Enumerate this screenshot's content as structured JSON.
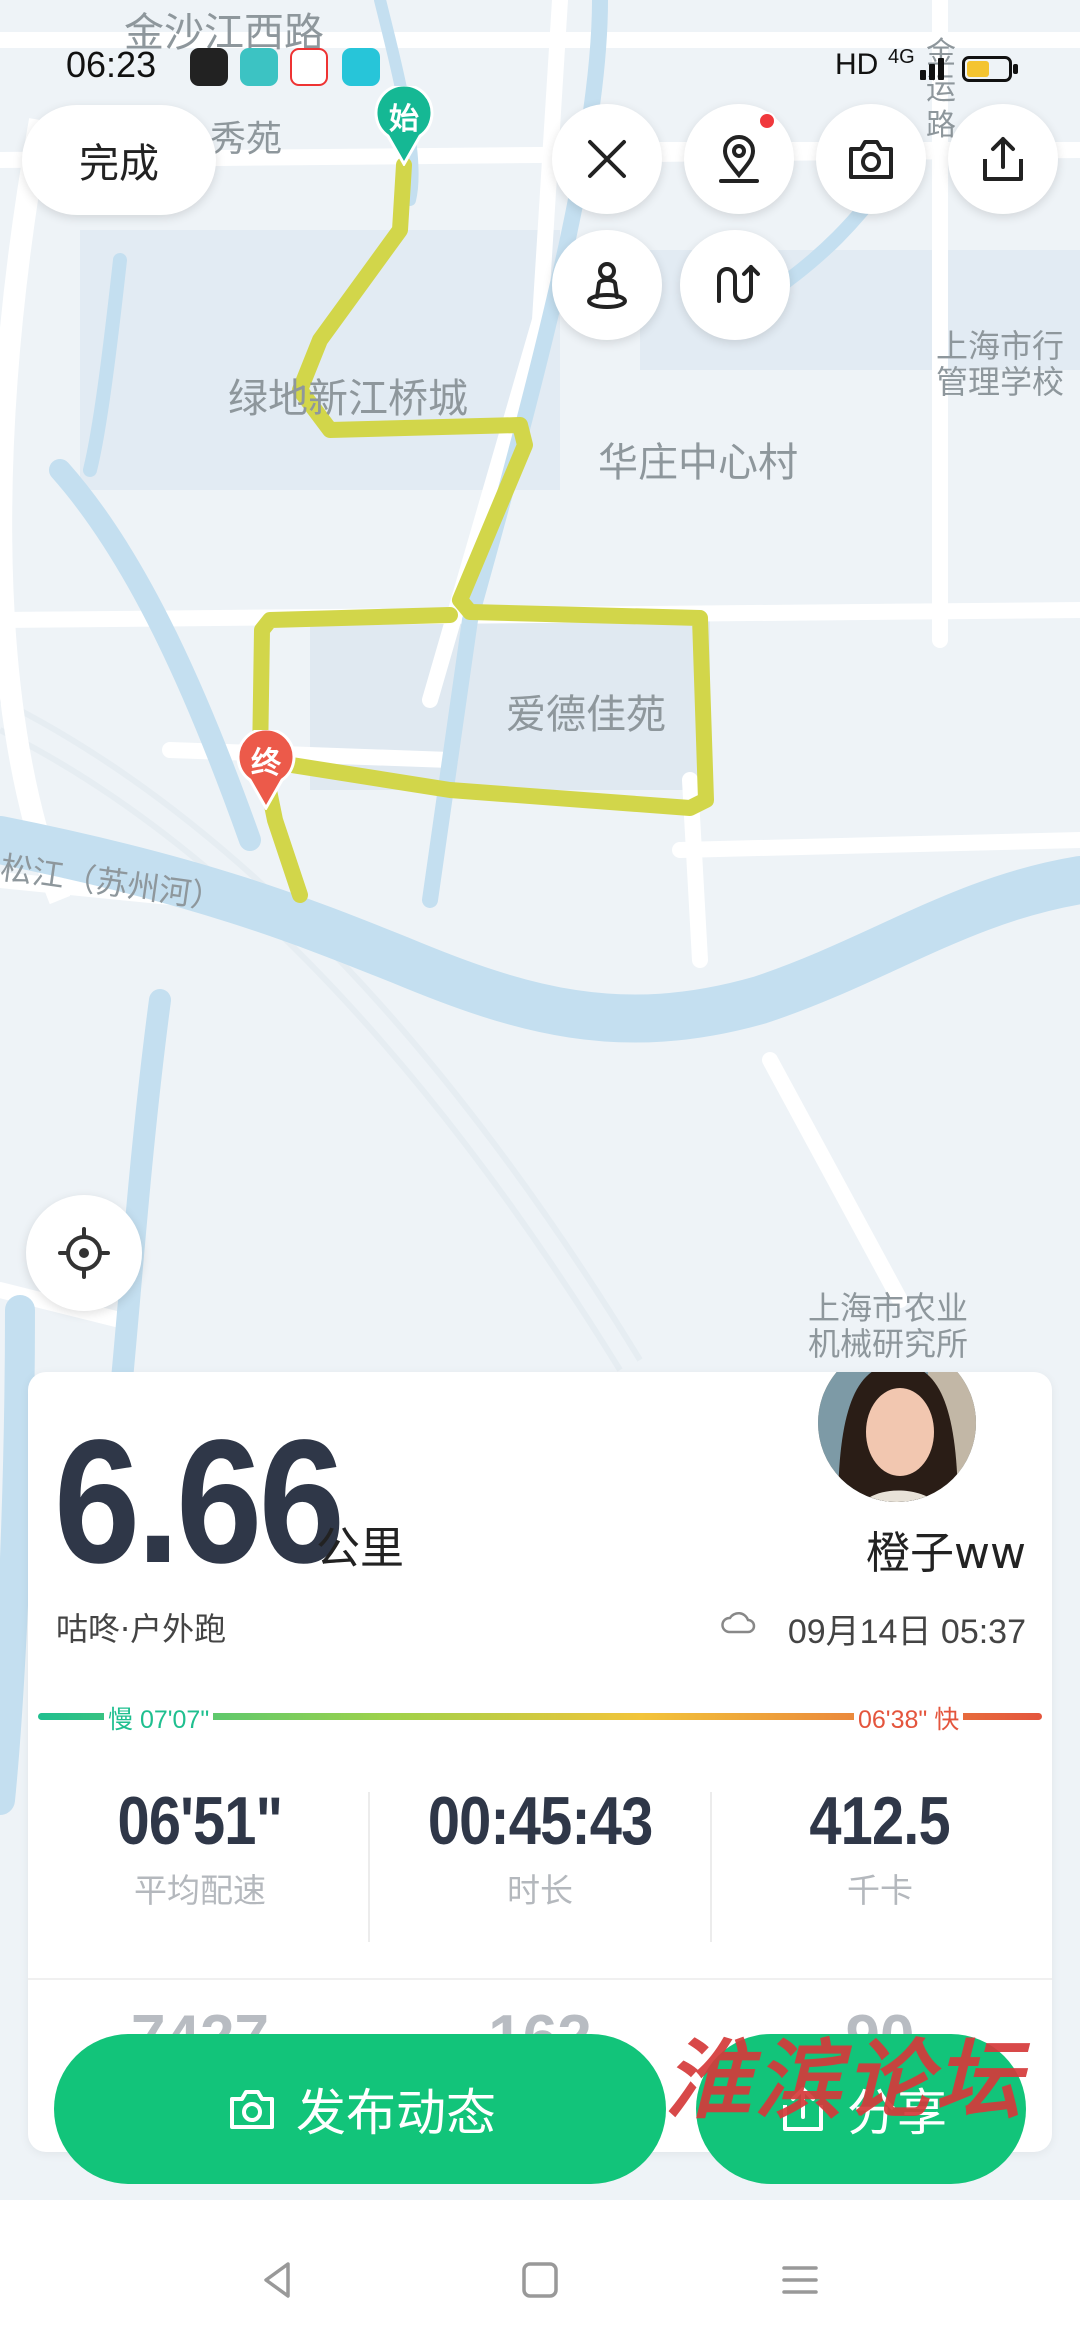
{
  "status_bar": {
    "time": "06:23",
    "network_type": "HD",
    "network_gen": "4G",
    "battery_level": 0.55,
    "battery_color": "#f4c430"
  },
  "map": {
    "labels": {
      "road_jinshajiang": "金沙江西路",
      "xiuyuan": "秀苑",
      "lvdi_xinjiangqiao": "绿地新江桥城",
      "huazhuang": "华庄中心村",
      "aidejia": "爱德佳苑",
      "suzhou_river": "松江（苏州河）",
      "admin_school_1": "上海市行",
      "admin_school_2": "管理学校",
      "agri_1": "上海市农业",
      "agri_2": "机械研究所",
      "yun_1": "金",
      "yun_2": "运",
      "yun_3": "路"
    },
    "start_marker": "始",
    "end_marker": "终",
    "route_color": "#d2d64a",
    "start_color": "#15b894",
    "end_color": "#ec5a4a"
  },
  "controls": {
    "done_label": "完成",
    "icons": [
      "close-icon",
      "location-pin-icon",
      "camera-icon",
      "share-icon",
      "person-icon",
      "route-icon",
      "crosshair-icon"
    ]
  },
  "summary": {
    "distance": "6.66",
    "distance_unit": "公里",
    "username": "橙子ww",
    "activity_type": "咕咚·户外跑",
    "date_time": "09月14日 05:37",
    "pace_slow_label": "慢 07'07\"",
    "pace_fast_label": "06'38\" 快",
    "stats": [
      {
        "value": "06'51\"",
        "label": "平均配速"
      },
      {
        "value": "00:45:43",
        "label": "时长"
      },
      {
        "value": "412.5",
        "label": "千卡"
      }
    ],
    "stats_partial": [
      "7427",
      "162",
      "90"
    ]
  },
  "actions": {
    "publish_label": "发布动态",
    "share_label": "分享"
  },
  "watermark": "淮滨论坛",
  "colors": {
    "accent_green": "#12c47a",
    "pace_start": "#1fbf8f",
    "pace_end": "#e4553d"
  }
}
